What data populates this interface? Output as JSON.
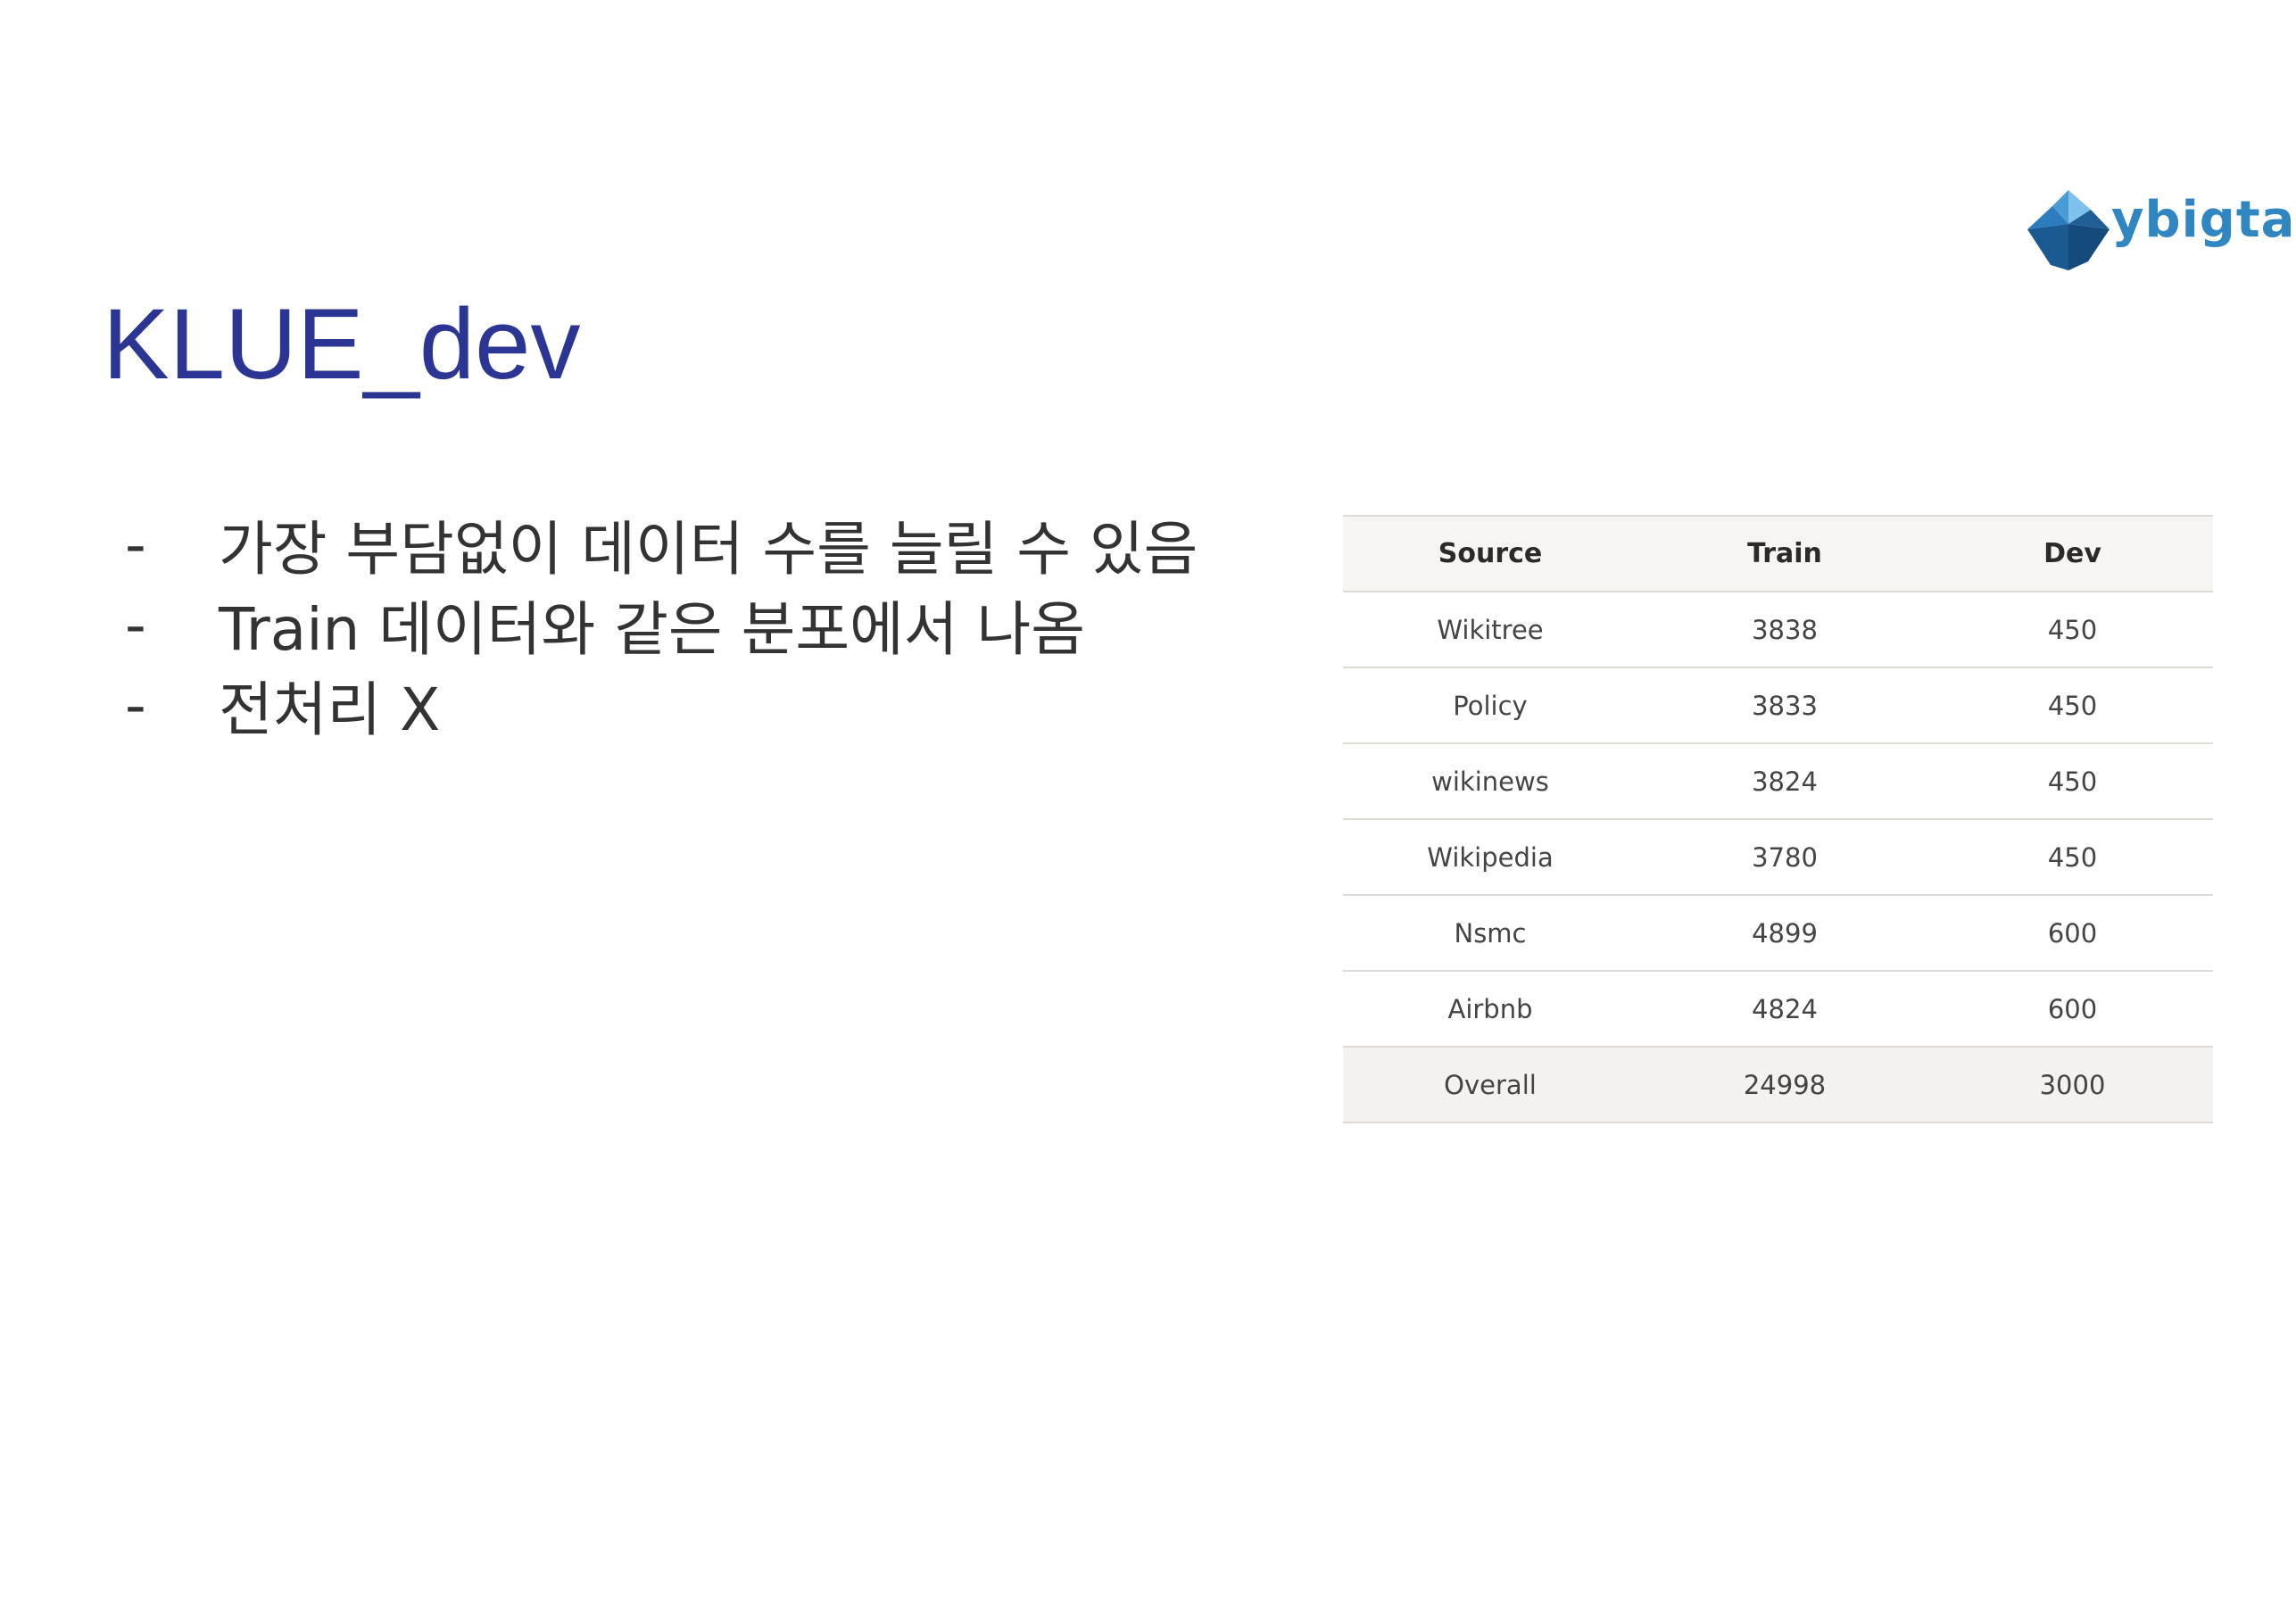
{
  "logo": {
    "text": "ybigta"
  },
  "title": "KLUE_dev",
  "bullets": [
    {
      "marker": "-",
      "text": "가장 부담없이 데이터 수를 늘릴 수 있음"
    },
    {
      "marker": "-",
      "text": "Train 데이터와 같은 분포에서 나옴"
    },
    {
      "marker": "-",
      "text": "전처리 X"
    }
  ],
  "table": {
    "headers": [
      "Source",
      "Train",
      "Dev"
    ],
    "rows": [
      [
        "Wikitree",
        "3838",
        "450"
      ],
      [
        "Policy",
        "3833",
        "450"
      ],
      [
        "wikinews",
        "3824",
        "450"
      ],
      [
        "Wikipedia",
        "3780",
        "450"
      ],
      [
        "Nsmc",
        "4899",
        "600"
      ],
      [
        "Airbnb",
        "4824",
        "600"
      ],
      [
        "Overall",
        "24998",
        "3000"
      ]
    ]
  },
  "colors": {
    "title": "#2b3593",
    "logo_dark": "#1f5f95",
    "logo_light": "#3b8fcb",
    "header_bg": "#f7f4f1"
  }
}
